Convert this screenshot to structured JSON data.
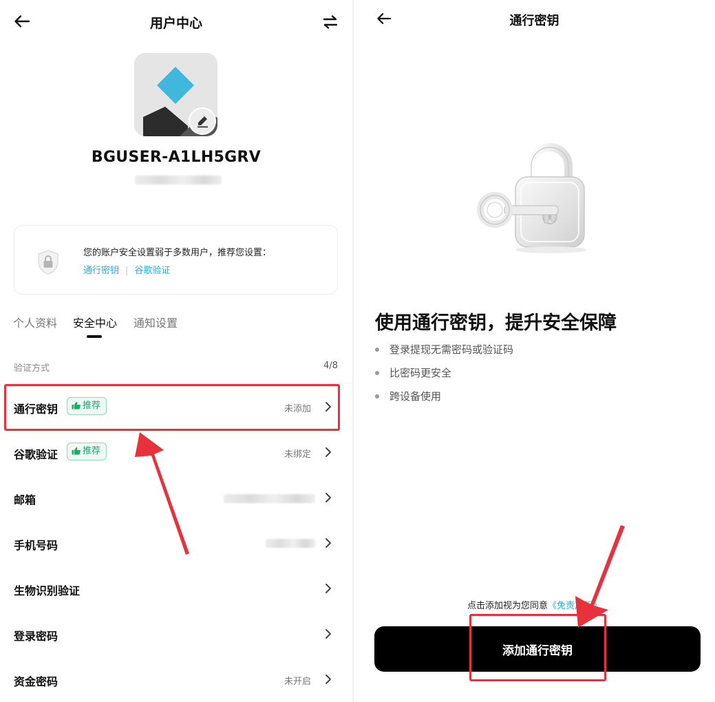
{
  "colors": {
    "accent_link": "#24aed4",
    "recommend_badge": "#1faa6e",
    "annotation_red": "#e8313a",
    "primary_button": "#000000",
    "logo_blue": "#40b7dc"
  },
  "user_center": {
    "header": {
      "back_icon": "arrow-left-icon",
      "title": "用户中心",
      "switch_icon": "swap-arrows-icon"
    },
    "profile": {
      "username": "BGUSER-A1LH5GRV",
      "edit_icon": "pencil-icon"
    },
    "security_notice": {
      "icon": "shield-lock-icon",
      "text": "您的账户安全设置弱于多数用户，推荐您设置：",
      "links": [
        "通行密钥",
        "谷歌验证"
      ],
      "separator": "|"
    },
    "tabs": [
      {
        "label": "个人资料",
        "active": false
      },
      {
        "label": "安全中心",
        "active": true
      },
      {
        "label": "通知设置",
        "active": false
      }
    ],
    "verification": {
      "section_label": "验证方式",
      "count": "4/8",
      "rows": [
        {
          "label": "通行密钥",
          "badge": "推荐",
          "status": "未添加",
          "highlighted": true
        },
        {
          "label": "谷歌验证",
          "badge": "推荐",
          "status": "未绑定",
          "highlighted": false
        },
        {
          "label": "邮箱",
          "badge": "",
          "status": "",
          "highlighted": false
        },
        {
          "label": "手机号码",
          "badge": "",
          "status": "",
          "highlighted": false
        },
        {
          "label": "生物识别验证",
          "badge": "",
          "status": "",
          "highlighted": false
        },
        {
          "label": "登录密码",
          "badge": "",
          "status": "",
          "highlighted": false
        },
        {
          "label": "资金密码",
          "badge": "",
          "status": "未开启",
          "highlighted": false
        }
      ],
      "badge_icon": "thumbs-up-icon",
      "chevron_icon": "chevron-right-icon"
    }
  },
  "passkey": {
    "header": {
      "back_icon": "arrow-left-icon",
      "title": "通行密钥"
    },
    "illustration": "padlock-with-key-icon",
    "heading": "使用通行密钥，提升安全保障",
    "bullets": [
      "登录提现无需密码或验证码",
      "比密码更安全",
      "跨设备使用"
    ],
    "agreement": {
      "prefix": "点击添加视为您同意",
      "link": "《免责声明》"
    },
    "add_button": "添加通行密钥"
  }
}
